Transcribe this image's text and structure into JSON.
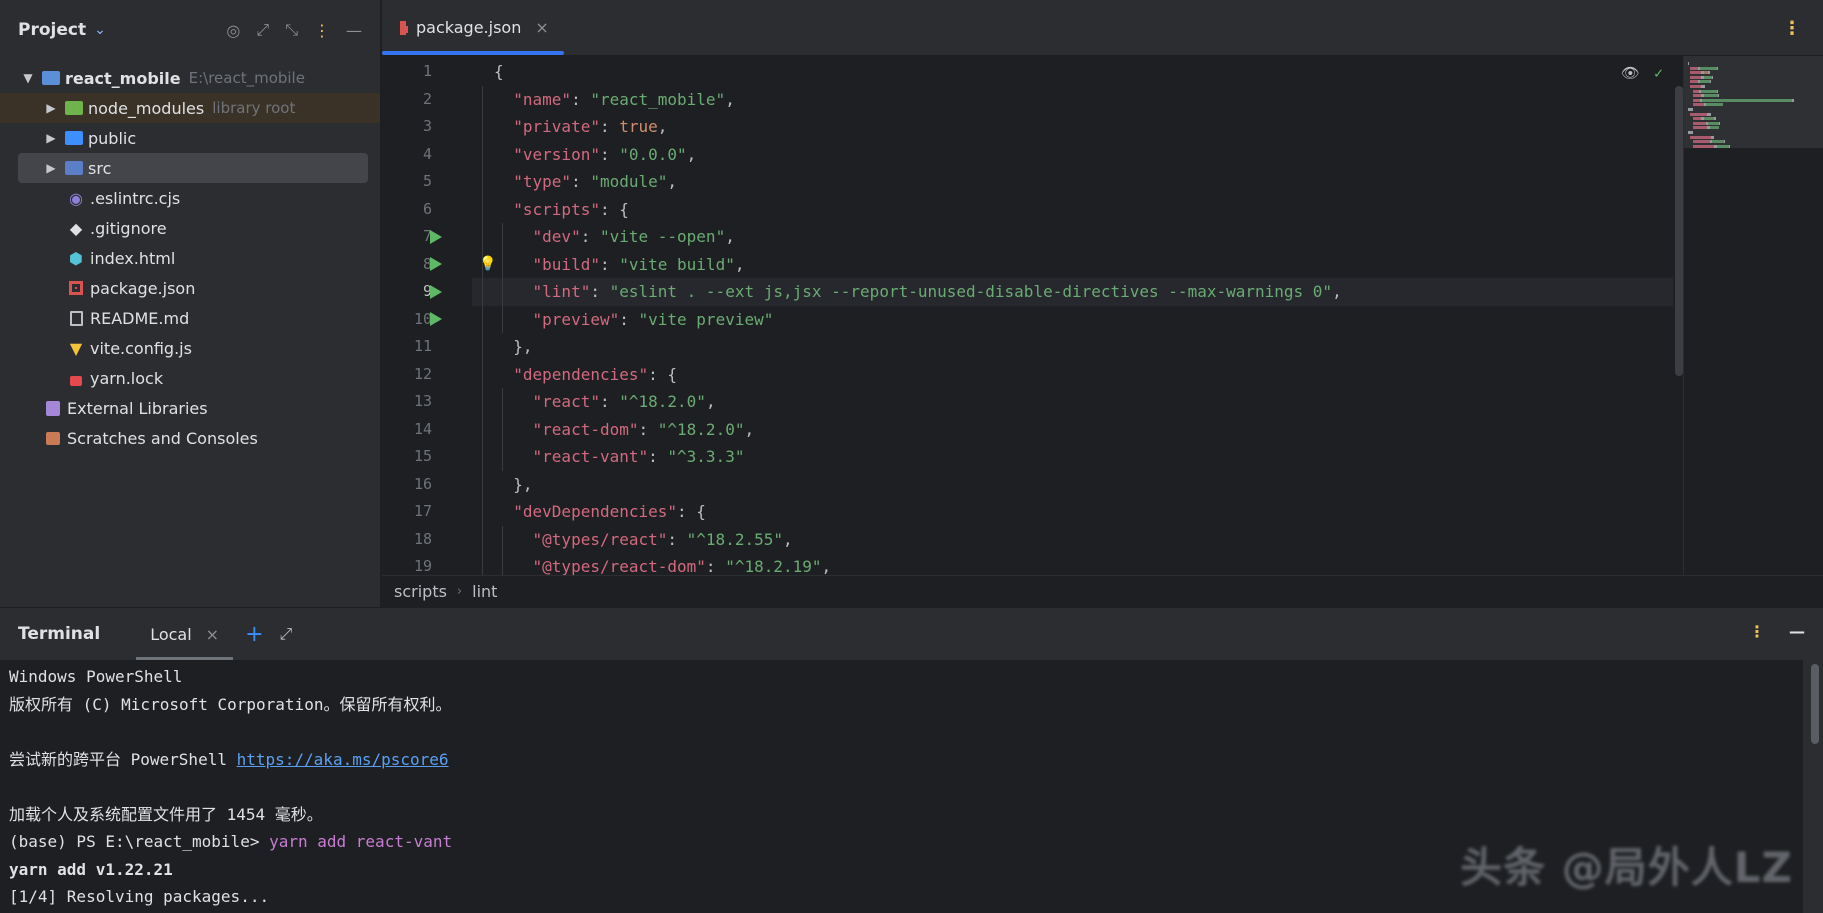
{
  "project_panel": {
    "title": "Project",
    "root": {
      "name": "react_mobile",
      "path": "E:\\react_mobile"
    },
    "items": [
      {
        "label": "node_modules",
        "hint": "library root"
      },
      {
        "label": "public"
      },
      {
        "label": "src"
      },
      {
        "label": ".eslintrc.cjs"
      },
      {
        "label": ".gitignore"
      },
      {
        "label": "index.html"
      },
      {
        "label": "package.json"
      },
      {
        "label": "README.md"
      },
      {
        "label": "vite.config.js"
      },
      {
        "label": "yarn.lock"
      },
      {
        "label": "External Libraries"
      },
      {
        "label": "Scratches and Consoles"
      }
    ]
  },
  "editor": {
    "tab": {
      "label": "package.json",
      "close": "×"
    },
    "line_numbers": [
      "1",
      "2",
      "3",
      "4",
      "5",
      "6",
      "7",
      "8",
      "9",
      "10",
      "11",
      "12",
      "13",
      "14",
      "15",
      "16",
      "17",
      "18",
      "19"
    ],
    "lines": [
      [
        [
          "p",
          "{"
        ]
      ],
      [
        [
          "p",
          "  "
        ],
        [
          "k",
          "\"name\""
        ],
        [
          "p",
          ": "
        ],
        [
          "s",
          "\"react_mobile\""
        ],
        [
          "p",
          ","
        ]
      ],
      [
        [
          "p",
          "  "
        ],
        [
          "k",
          "\"private\""
        ],
        [
          "p",
          ": "
        ],
        [
          "b",
          "true"
        ],
        [
          "p",
          ","
        ]
      ],
      [
        [
          "p",
          "  "
        ],
        [
          "k",
          "\"version\""
        ],
        [
          "p",
          ": "
        ],
        [
          "s",
          "\"0.0.0\""
        ],
        [
          "p",
          ","
        ]
      ],
      [
        [
          "p",
          "  "
        ],
        [
          "k",
          "\"type\""
        ],
        [
          "p",
          ": "
        ],
        [
          "s",
          "\"module\""
        ],
        [
          "p",
          ","
        ]
      ],
      [
        [
          "p",
          "  "
        ],
        [
          "k",
          "\"scripts\""
        ],
        [
          "p",
          ": {"
        ]
      ],
      [
        [
          "p",
          "    "
        ],
        [
          "k",
          "\"dev\""
        ],
        [
          "p",
          ": "
        ],
        [
          "s",
          "\"vite --open\""
        ],
        [
          "p",
          ","
        ]
      ],
      [
        [
          "p",
          "    "
        ],
        [
          "k",
          "\"build\""
        ],
        [
          "p",
          ": "
        ],
        [
          "s",
          "\"vite build\""
        ],
        [
          "p",
          ","
        ]
      ],
      [
        [
          "p",
          "    "
        ],
        [
          "k",
          "\"lint\""
        ],
        [
          "p",
          ": "
        ],
        [
          "s",
          "\"eslint . --ext js,jsx --report-unused-disable-directives --max-warnings 0\""
        ],
        [
          "p",
          ","
        ]
      ],
      [
        [
          "p",
          "    "
        ],
        [
          "k",
          "\"preview\""
        ],
        [
          "p",
          ": "
        ],
        [
          "s",
          "\"vite preview\""
        ]
      ],
      [
        [
          "p",
          "  },"
        ]
      ],
      [
        [
          "p",
          "  "
        ],
        [
          "k",
          "\"dependencies\""
        ],
        [
          "p",
          ": {"
        ]
      ],
      [
        [
          "p",
          "    "
        ],
        [
          "k",
          "\"react\""
        ],
        [
          "p",
          ": "
        ],
        [
          "s",
          "\"^18.2.0\""
        ],
        [
          "p",
          ","
        ]
      ],
      [
        [
          "p",
          "    "
        ],
        [
          "k",
          "\"react-dom\""
        ],
        [
          "p",
          ": "
        ],
        [
          "s",
          "\"^18.2.0\""
        ],
        [
          "p",
          ","
        ]
      ],
      [
        [
          "p",
          "    "
        ],
        [
          "k",
          "\"react-vant\""
        ],
        [
          "p",
          ": "
        ],
        [
          "s",
          "\"^3.3.3\""
        ]
      ],
      [
        [
          "p",
          "  },"
        ]
      ],
      [
        [
          "p",
          "  "
        ],
        [
          "k",
          "\"devDependencies\""
        ],
        [
          "p",
          ": {"
        ]
      ],
      [
        [
          "p",
          "    "
        ],
        [
          "k",
          "\"@types/react\""
        ],
        [
          "p",
          ": "
        ],
        [
          "s",
          "\"^18.2.55\""
        ],
        [
          "p",
          ","
        ]
      ],
      [
        [
          "p",
          "    "
        ],
        [
          "k",
          "\"@types/react-dom\""
        ],
        [
          "p",
          ": "
        ],
        [
          "s",
          "\"^18.2.19\""
        ],
        [
          "p",
          ","
        ]
      ]
    ],
    "breadcrumbs": [
      "scripts",
      "lint"
    ],
    "colors": {
      "key": "#d16a7f",
      "string": "#6aab73",
      "bool": "#cf8e6d",
      "punct": "#bcbec4"
    }
  },
  "terminal": {
    "title": "Terminal",
    "tab": {
      "label": "Local",
      "close": "×"
    },
    "lines": [
      {
        "text": "Windows PowerShell"
      },
      {
        "text": "版权所有 (C) Microsoft Corporation。保留所有权利。"
      },
      {
        "text": ""
      },
      {
        "text": "尝试新的跨平台 PowerShell ",
        "link": "https://aka.ms/pscore6"
      },
      {
        "text": ""
      },
      {
        "text": "加载个人及系统配置文件用了 1454 毫秒。"
      },
      {
        "text": "(base) PS E:\\react_mobile> ",
        "cmd": "yarn add react-vant"
      },
      {
        "text": "yarn add v1.22.21",
        "bold": true
      },
      {
        "text": "[1/4] Resolving packages..."
      }
    ],
    "watermark": "头条 @局外人LZ"
  }
}
